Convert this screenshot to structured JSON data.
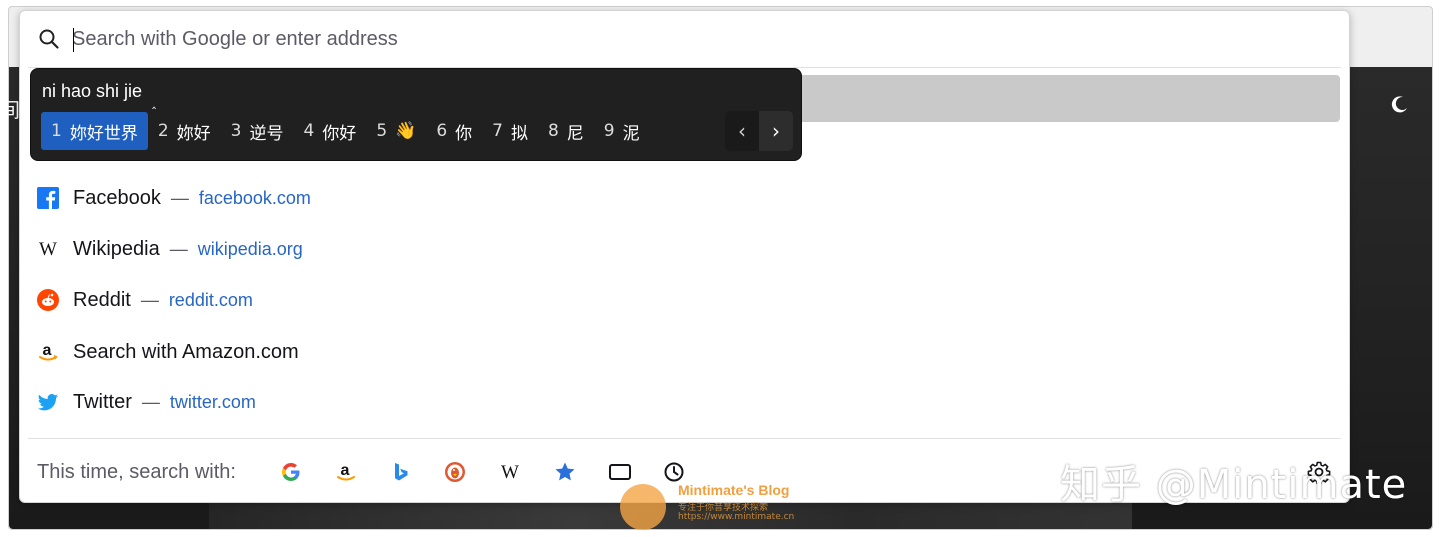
{
  "urlbar": {
    "placeholder": "Search with Google or enter address",
    "value": ""
  },
  "ime": {
    "pinyin": "ni hao shi jie",
    "candidates": [
      {
        "num": "1",
        "text": "妳好世界"
      },
      {
        "num": "2",
        "text": "妳好"
      },
      {
        "num": "3",
        "text": "逆号"
      },
      {
        "num": "4",
        "text": "你好"
      },
      {
        "num": "5",
        "text": "👋"
      },
      {
        "num": "6",
        "text": "你"
      },
      {
        "num": "7",
        "text": "拟"
      },
      {
        "num": "8",
        "text": "尼"
      },
      {
        "num": "9",
        "text": "泥"
      }
    ],
    "selected_index": 0,
    "prev": "‹",
    "next": "›"
  },
  "results": [
    {
      "title": "Facebook",
      "sep": "—",
      "url": "facebook.com",
      "icon": "facebook-icon"
    },
    {
      "title": "Wikipedia",
      "sep": "—",
      "url": "wikipedia.org",
      "icon": "wikipedia-icon"
    },
    {
      "title": "Reddit",
      "sep": "—",
      "url": "reddit.com",
      "icon": "reddit-icon"
    },
    {
      "title": "Search with Amazon.com",
      "sep": "",
      "url": "",
      "icon": "amazon-icon"
    },
    {
      "title": "Twitter",
      "sep": "—",
      "url": "twitter.com",
      "icon": "twitter-icon"
    }
  ],
  "oneoff": {
    "label": "This time, search with:",
    "engines": [
      "google-icon",
      "amazon-icon",
      "bing-icon",
      "duckduckgo-icon",
      "wikipedia-icon",
      "bookmarks-icon",
      "tabs-icon",
      "history-icon"
    ]
  },
  "background": {
    "left_glyph": "间"
  },
  "watermarks": {
    "blog_title": "Mintimate's Blog",
    "blog_sub": "专注于你音享技术探索",
    "blog_url": "https://www.mintimate.cn",
    "zhihu": "知乎 @Mintimate"
  },
  "colors": {
    "link": "#2766c4",
    "ime_selected": "#1e5fc0",
    "ime_bg": "#202020",
    "highlight_row": "#c9c9c9",
    "facebook": "#1877f2",
    "reddit": "#ff4500",
    "twitter": "#1da1f2",
    "bookmark_star": "#2a6fdb"
  }
}
